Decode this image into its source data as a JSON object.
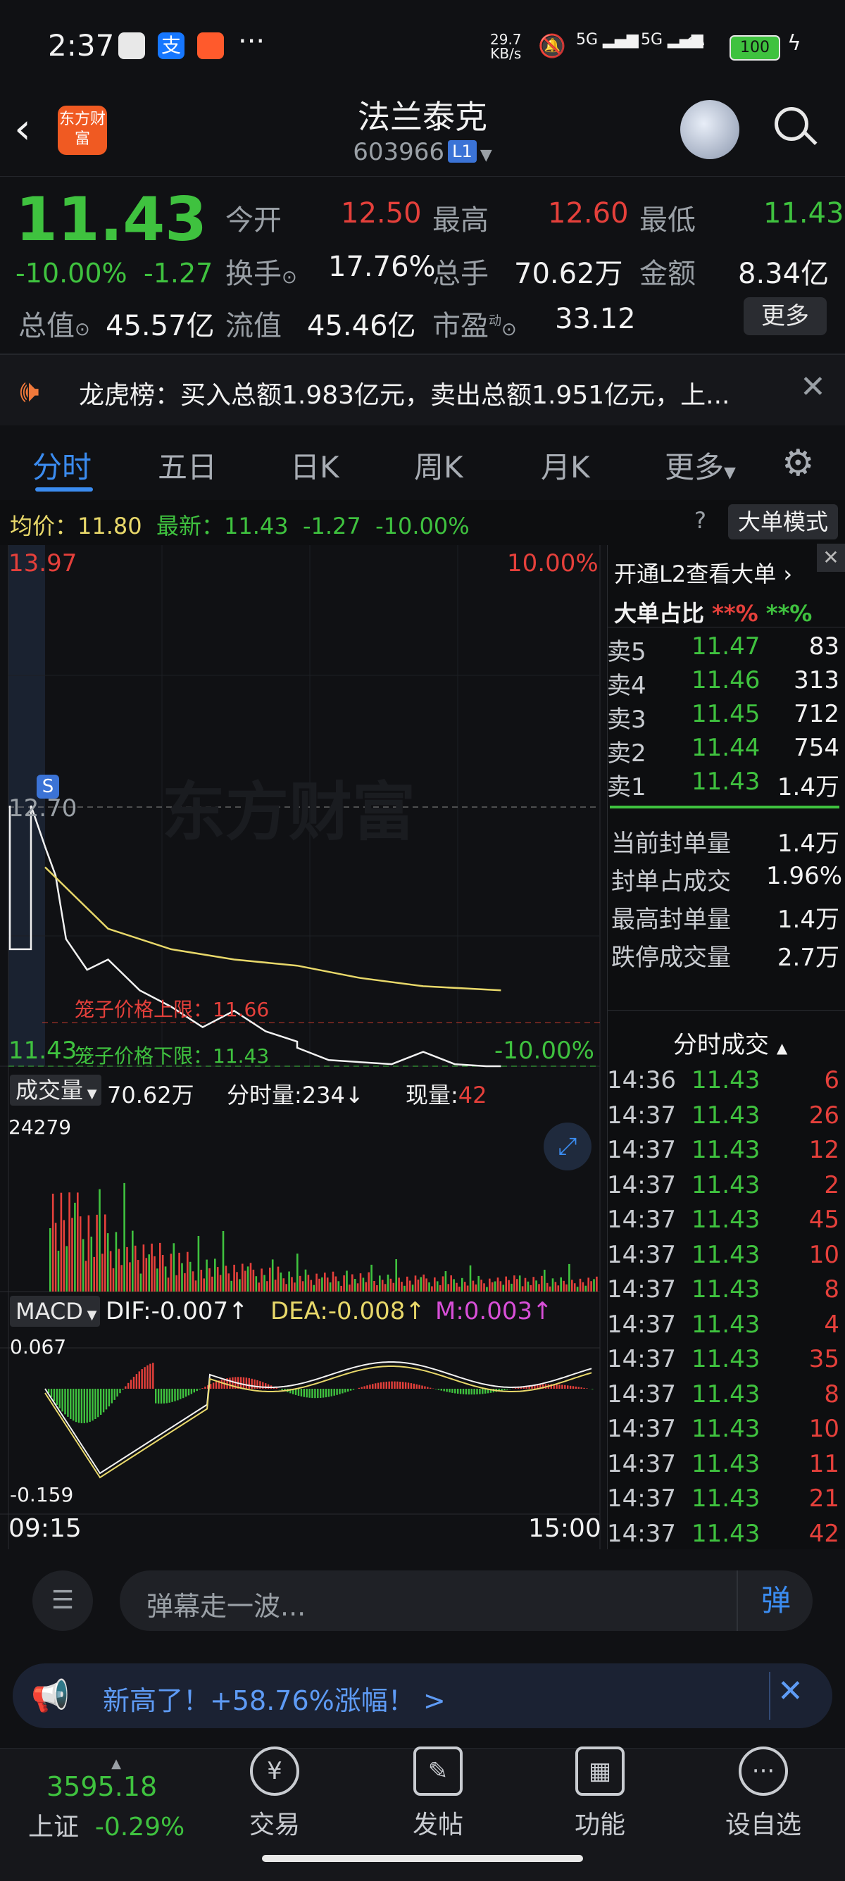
{
  "status_bar": {
    "time": "2:37",
    "net_speed_top": "29.7",
    "net_speed_unit": "KB/s",
    "signal_1": "5G",
    "signal_2": "5G",
    "battery": "100"
  },
  "header": {
    "app_logo": "东方财富",
    "stock_name": "法兰泰克",
    "stock_code": "603966",
    "level_badge": "L1"
  },
  "quote": {
    "price": "11.43",
    "change_pct": "-10.00%",
    "change_amt": "-1.27",
    "open_label": "今开",
    "open": "12.50",
    "high_label": "最高",
    "high": "12.60",
    "low_label": "最低",
    "low": "11.43",
    "turnover_label": "换手",
    "turnover": "17.76%",
    "volume_label": "总手",
    "volume": "70.62万",
    "amount_label": "金额",
    "amount": "8.34亿",
    "mktcap_label": "总值",
    "mktcap": "45.57亿",
    "float_label": "流值",
    "float": "45.46亿",
    "pe_label": "市盈",
    "pe_sup": "动",
    "pe": "33.12",
    "more_button": "更多"
  },
  "notice": {
    "text": "龙虎榜：买入总额1.983亿元，卖出总额1.951亿元，上..."
  },
  "tabs": [
    "分时",
    "五日",
    "日K",
    "周K",
    "月K",
    "更多"
  ],
  "info_line": {
    "avg_label": "均价：",
    "avg": "11.80",
    "latest_label": "最新：",
    "latest": "11.43",
    "change": "-1.27",
    "change_pct": "-10.00%",
    "big_order_mode": "大单模式"
  },
  "chart": {
    "top_price": "13.97",
    "top_pct": "10.00%",
    "ref_price": "12.70",
    "bottom_price": "11.43",
    "bottom_pct": "-10.00%",
    "upper_cage": "笼子价格上限：11.66",
    "lower_cage": "笼子价格下限：11.43",
    "watermark": "东方财富",
    "marker": "S",
    "volume_label": "成交量",
    "volume_total": "70.62万",
    "minute_vol": "分时量:234↓",
    "current_vol_label": "现量:",
    "current_vol": "42",
    "vol_max": "24279",
    "macd_label": "MACD",
    "dif": "DIF:-0.007↑",
    "dea": "DEA:-0.008↑",
    "m": "M:0.003↑",
    "macd_max": "0.067",
    "macd_min": "-0.159",
    "time_start": "09:15",
    "time_end": "15:00"
  },
  "chart_data": {
    "type": "line",
    "series": [
      {
        "name": "最新",
        "x": [
          "09:30",
          "09:35",
          "09:40",
          "09:50",
          "10:00",
          "10:15",
          "10:30",
          "10:45",
          "11:00",
          "11:15",
          "11:30",
          "13:00",
          "13:15",
          "13:30",
          "13:45",
          "14:00",
          "14:15",
          "14:30",
          "14:37"
        ],
        "values": [
          12.5,
          12.36,
          12.05,
          11.9,
          11.95,
          11.8,
          11.72,
          11.62,
          11.7,
          11.6,
          11.55,
          11.52,
          11.46,
          11.45,
          11.44,
          11.5,
          11.44,
          11.43,
          11.43
        ]
      },
      {
        "name": "均价",
        "x": [
          "09:30",
          "10:00",
          "10:30",
          "11:00",
          "11:30",
          "13:30",
          "14:00",
          "14:37"
        ],
        "values": [
          12.4,
          12.1,
          12.0,
          11.95,
          11.92,
          11.86,
          11.82,
          11.8
        ]
      }
    ],
    "ylim": [
      11.43,
      13.97
    ],
    "ref": 12.7
  },
  "order_book": {
    "unlock_text": "开通L2查看大单 ›",
    "ratio_label": "大单占比",
    "ratio_red": "**%",
    "ratio_green": "**%",
    "asks": [
      {
        "label": "卖5",
        "price": "11.47",
        "qty": "83"
      },
      {
        "label": "卖4",
        "price": "11.46",
        "qty": "313"
      },
      {
        "label": "卖3",
        "price": "11.45",
        "qty": "712"
      },
      {
        "label": "卖2",
        "price": "11.44",
        "qty": "754"
      },
      {
        "label": "卖1",
        "price": "11.43",
        "qty": "1.4万"
      }
    ],
    "stats": [
      {
        "label": "当前封单量",
        "value": "1.4万"
      },
      {
        "label": "封单占成交",
        "value": "1.96%"
      },
      {
        "label": "最高封单量",
        "value": "1.4万"
      },
      {
        "label": "跌停成交量",
        "value": "2.7万"
      }
    ],
    "ticks_title": "分时成交",
    "ticks": [
      {
        "time": "14:36",
        "price": "11.43",
        "qty": "6"
      },
      {
        "time": "14:37",
        "price": "11.43",
        "qty": "26"
      },
      {
        "time": "14:37",
        "price": "11.43",
        "qty": "12"
      },
      {
        "time": "14:37",
        "price": "11.43",
        "qty": "2"
      },
      {
        "time": "14:37",
        "price": "11.43",
        "qty": "45"
      },
      {
        "time": "14:37",
        "price": "11.43",
        "qty": "10"
      },
      {
        "time": "14:37",
        "price": "11.43",
        "qty": "8"
      },
      {
        "time": "14:37",
        "price": "11.43",
        "qty": "4"
      },
      {
        "time": "14:37",
        "price": "11.43",
        "qty": "35"
      },
      {
        "time": "14:37",
        "price": "11.43",
        "qty": "8"
      },
      {
        "time": "14:37",
        "price": "11.43",
        "qty": "10"
      },
      {
        "time": "14:37",
        "price": "11.43",
        "qty": "11"
      },
      {
        "time": "14:37",
        "price": "11.43",
        "qty": "21"
      },
      {
        "time": "14:37",
        "price": "11.43",
        "qty": "42"
      }
    ]
  },
  "comment_bar": {
    "placeholder": "弹幕走一波...",
    "danmu_button": "弹"
  },
  "promo": {
    "text": "新高了！+58.76%涨幅！ >"
  },
  "bottom_nav": {
    "index_value": "3595.18",
    "index_name": "上证",
    "index_change": "-0.29%",
    "items": [
      "交易",
      "发帖",
      "功能",
      "设自选"
    ]
  }
}
